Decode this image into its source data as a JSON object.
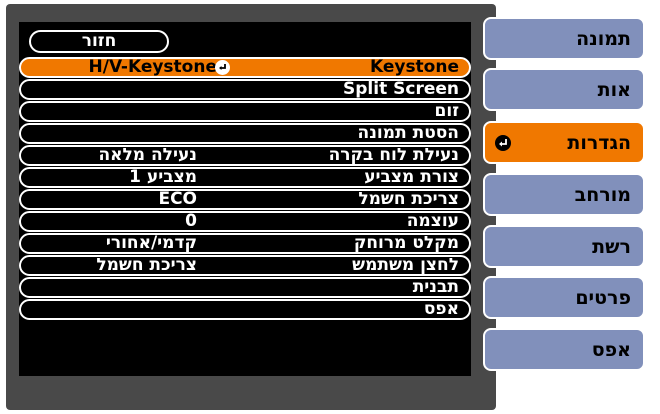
{
  "back_label": "חזור",
  "menu": [
    {
      "label": "Keystone",
      "value": "H/V-Keystone",
      "selected": true
    },
    {
      "label": "Split Screen",
      "value": ""
    },
    {
      "label": "זום",
      "value": ""
    },
    {
      "label": "הסטת תמונה",
      "value": ""
    },
    {
      "label": "נעילת לוח בקרה",
      "value": "נעילה מלאה"
    },
    {
      "label": "צורת מצביע",
      "value": "מצביע 1"
    },
    {
      "label": "צריכת חשמל",
      "value": "ECO"
    },
    {
      "label": "עוצמה",
      "value": "0"
    },
    {
      "label": "מקלט מרוחק",
      "value": "קדמי/אחורי"
    },
    {
      "label": "לחצן משתמש",
      "value": "צריכת חשמל"
    },
    {
      "label": "תבנית",
      "value": ""
    },
    {
      "label": "אפס",
      "value": ""
    }
  ],
  "tabs": [
    {
      "label": "תמונה"
    },
    {
      "label": "אות"
    },
    {
      "label": "הגדרות",
      "active": true
    },
    {
      "label": "מורחב"
    },
    {
      "label": "רשת"
    },
    {
      "label": "פרטים"
    },
    {
      "label": "אפס"
    }
  ],
  "colors": {
    "accent": "#f07800",
    "tab_bg": "#8190bb",
    "panel_bg": "#494949"
  },
  "icons": {
    "enter": "enter-icon"
  }
}
